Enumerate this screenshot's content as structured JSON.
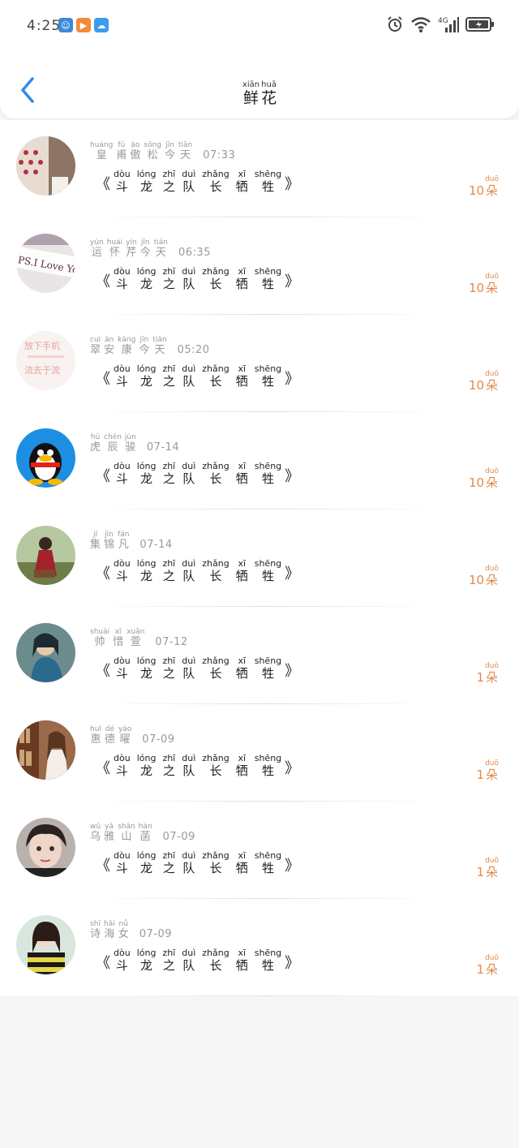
{
  "status": {
    "time": "4:25",
    "network": "4G",
    "app_icons": [
      {
        "name": "game-app-icon",
        "color": "#3b8ad9",
        "glyph": "☺"
      },
      {
        "name": "video-app-icon",
        "color": "#f08c3a",
        "glyph": "▶"
      },
      {
        "name": "cloud-app-icon",
        "color": "#3c9bf0",
        "glyph": "☁"
      }
    ]
  },
  "header": {
    "title": [
      {
        "py": "xiān",
        "hz": "鲜"
      },
      {
        "py": "huā",
        "hz": "花"
      }
    ]
  },
  "colors": {
    "accent": "#2d8ee8",
    "count": "#e08a4a"
  },
  "book_title": [
    {
      "py": "dòu",
      "hz": "斗"
    },
    {
      "py": "lóng",
      "hz": "龙"
    },
    {
      "py": "zhī",
      "hz": "之"
    },
    {
      "py": "duì",
      "hz": "队"
    },
    {
      "py": "zhǎng",
      "hz": "长"
    },
    {
      "py": "xī",
      "hz": "牺"
    },
    {
      "py": "shēng",
      "hz": "牲"
    }
  ],
  "count_suffix": {
    "py": "duō",
    "hz": "朵"
  },
  "rows": [
    {
      "name": [
        {
          "py": "huáng",
          "hz": "皇"
        },
        {
          "py": "fǔ",
          "hz": "甫"
        },
        {
          "py": "ào",
          "hz": "傲"
        },
        {
          "py": "sōng",
          "hz": "松"
        },
        {
          "py": "jīn",
          "hz": "今"
        },
        {
          "py": "tiān",
          "hz": "天"
        }
      ],
      "date": "07:33",
      "count": "10",
      "avatar": "pattern"
    },
    {
      "name": [
        {
          "py": "yùn",
          "hz": "运"
        },
        {
          "py": "huái",
          "hz": "怀"
        },
        {
          "py": "yín",
          "hz": "芹"
        },
        {
          "py": "jīn",
          "hz": "今"
        },
        {
          "py": "tiān",
          "hz": "天"
        }
      ],
      "date": "06:35",
      "count": "10",
      "avatar": "ps"
    },
    {
      "name": [
        {
          "py": "cuì",
          "hz": "翠"
        },
        {
          "py": "ān",
          "hz": "安"
        },
        {
          "py": "kāng",
          "hz": "康"
        },
        {
          "py": "jīn",
          "hz": "今"
        },
        {
          "py": "tiān",
          "hz": "天"
        }
      ],
      "date": "05:20",
      "count": "10",
      "avatar": "text"
    },
    {
      "name": [
        {
          "py": "hǔ",
          "hz": "虎"
        },
        {
          "py": "chén",
          "hz": "辰"
        },
        {
          "py": "jùn",
          "hz": "骏"
        }
      ],
      "date": "07-14",
      "count": "10",
      "avatar": "qq"
    },
    {
      "name": [
        {
          "py": "jí",
          "hz": "集"
        },
        {
          "py": "jīn",
          "hz": "锦"
        },
        {
          "py": "fán",
          "hz": "凡"
        }
      ],
      "date": "07-14",
      "count": "10",
      "avatar": "red"
    },
    {
      "name": [
        {
          "py": "shuài",
          "hz": "帅"
        },
        {
          "py": "xī",
          "hz": "惜"
        },
        {
          "py": "xuān",
          "hz": "萱"
        }
      ],
      "date": "07-12",
      "count": "1",
      "avatar": "blue"
    },
    {
      "name": [
        {
          "py": "huì",
          "hz": "惠"
        },
        {
          "py": "dé",
          "hz": "德"
        },
        {
          "py": "yào",
          "hz": "曜"
        }
      ],
      "date": "07-09",
      "count": "1",
      "avatar": "shelf"
    },
    {
      "name": [
        {
          "py": "wū",
          "hz": "乌"
        },
        {
          "py": "yǎ",
          "hz": "雅"
        },
        {
          "py": "shān",
          "hz": "山"
        },
        {
          "py": "hàn",
          "hz": "菡"
        }
      ],
      "date": "07-09",
      "count": "1",
      "avatar": "face"
    },
    {
      "name": [
        {
          "py": "shī",
          "hz": "诗"
        },
        {
          "py": "hǎi",
          "hz": "海"
        },
        {
          "py": "nǚ",
          "hz": "女"
        }
      ],
      "date": "07-09",
      "count": "1",
      "avatar": "stripe"
    }
  ]
}
